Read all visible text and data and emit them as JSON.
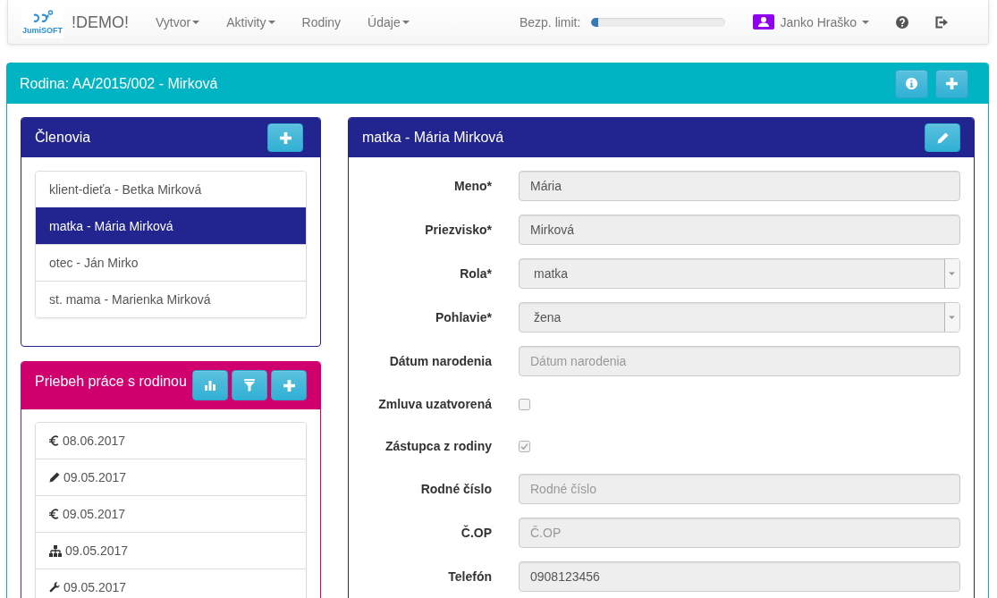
{
  "navbar": {
    "logo_text": "JumiSOFT",
    "brand": "!DEMO!",
    "menu": [
      {
        "label": "Vytvor",
        "dropdown": true
      },
      {
        "label": "Aktivity",
        "dropdown": true
      },
      {
        "label": "Rodiny",
        "dropdown": false
      },
      {
        "label": "Údaje",
        "dropdown": true
      }
    ],
    "limit": {
      "label": "Bezp. limit:",
      "level": 0.05
    },
    "user": {
      "name": "Janko Hraško",
      "dropdown": true
    }
  },
  "family_panel": {
    "title": "Rodina: AA/2015/002 - Mirková"
  },
  "members_panel": {
    "title": "Členovia",
    "members": [
      {
        "label": "klient-dieťa - Betka Mirková",
        "selected": false
      },
      {
        "label": "matka - Mária Mirková",
        "selected": true
      },
      {
        "label": "otec - Ján Mirko",
        "selected": false
      },
      {
        "label": "st. mama - Marienka Mirková",
        "selected": false
      }
    ]
  },
  "work_panel": {
    "title": "Priebeh práce s rodinou",
    "entries": [
      {
        "kind": "payment",
        "date": "08.06.2017"
      },
      {
        "kind": "note",
        "date": "09.05.2017"
      },
      {
        "kind": "payment",
        "date": "09.05.2017"
      },
      {
        "kind": "structure",
        "date": "09.05.2017"
      },
      {
        "kind": "tool",
        "date": "09.05.2017"
      }
    ]
  },
  "detail_panel": {
    "title": "matka - Mária Mirková",
    "fields": [
      {
        "kind": "text",
        "label": "Meno*",
        "value": "Mária",
        "disabled": true
      },
      {
        "kind": "text",
        "label": "Priezvisko*",
        "value": "Mirková",
        "disabled": true
      },
      {
        "kind": "select",
        "label": "Rola*",
        "value": "matka",
        "disabled": true
      },
      {
        "kind": "select",
        "label": "Pohlavie*",
        "value": "žena",
        "disabled": true
      },
      {
        "kind": "text",
        "label": "Dátum narodenia",
        "placeholder": "Dátum narodenia",
        "disabled": true
      },
      {
        "kind": "checkbox",
        "label": "Zmluva uzatvorená",
        "checked": false,
        "disabled": true
      },
      {
        "kind": "checkbox",
        "label": "Zástupca z rodiny",
        "checked": true,
        "disabled": true
      },
      {
        "kind": "text",
        "label": "Rodné číslo",
        "placeholder": "Rodné číslo",
        "disabled": true
      },
      {
        "kind": "text",
        "label": "Č.OP",
        "placeholder": "Č.OP",
        "disabled": true
      },
      {
        "kind": "text",
        "label": "Telefón",
        "value": "0908123456",
        "disabled": true
      }
    ]
  }
}
